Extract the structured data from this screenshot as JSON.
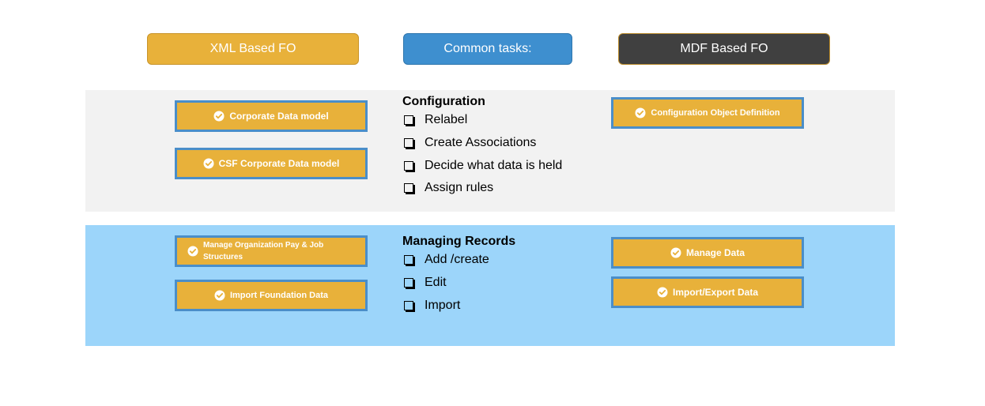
{
  "headers": {
    "xml": "XML Based FO",
    "common": "Common tasks:",
    "mdf": "MDF Based FO"
  },
  "configuration": {
    "title": "Configuration",
    "items": [
      "Relabel",
      "Create Associations",
      "Decide what data is held",
      "Assign rules"
    ],
    "xml_buttons": [
      "Corporate Data model",
      "CSF Corporate Data model"
    ],
    "mdf_buttons": [
      "Configuration Object Definition"
    ]
  },
  "managing_records": {
    "title": "Managing Records",
    "items": [
      "Add /create",
      "Edit",
      "Import"
    ],
    "xml_buttons": [
      "Manage Organization Pay & Job Structures",
      "Import Foundation Data"
    ],
    "mdf_buttons": [
      "Manage Data",
      "Import/Export Data"
    ]
  },
  "icons": {
    "button_icon": "check-circle-icon",
    "list_icon": "checkbox-icon"
  },
  "colors": {
    "xml_header": "#e8b13a",
    "common_header": "#3e8fcf",
    "mdf_header": "#404040",
    "task_button": "#e8b13a",
    "task_button_border": "#4a8ec9",
    "config_band": "#f2f2f2",
    "records_band": "#9cd5fa"
  }
}
